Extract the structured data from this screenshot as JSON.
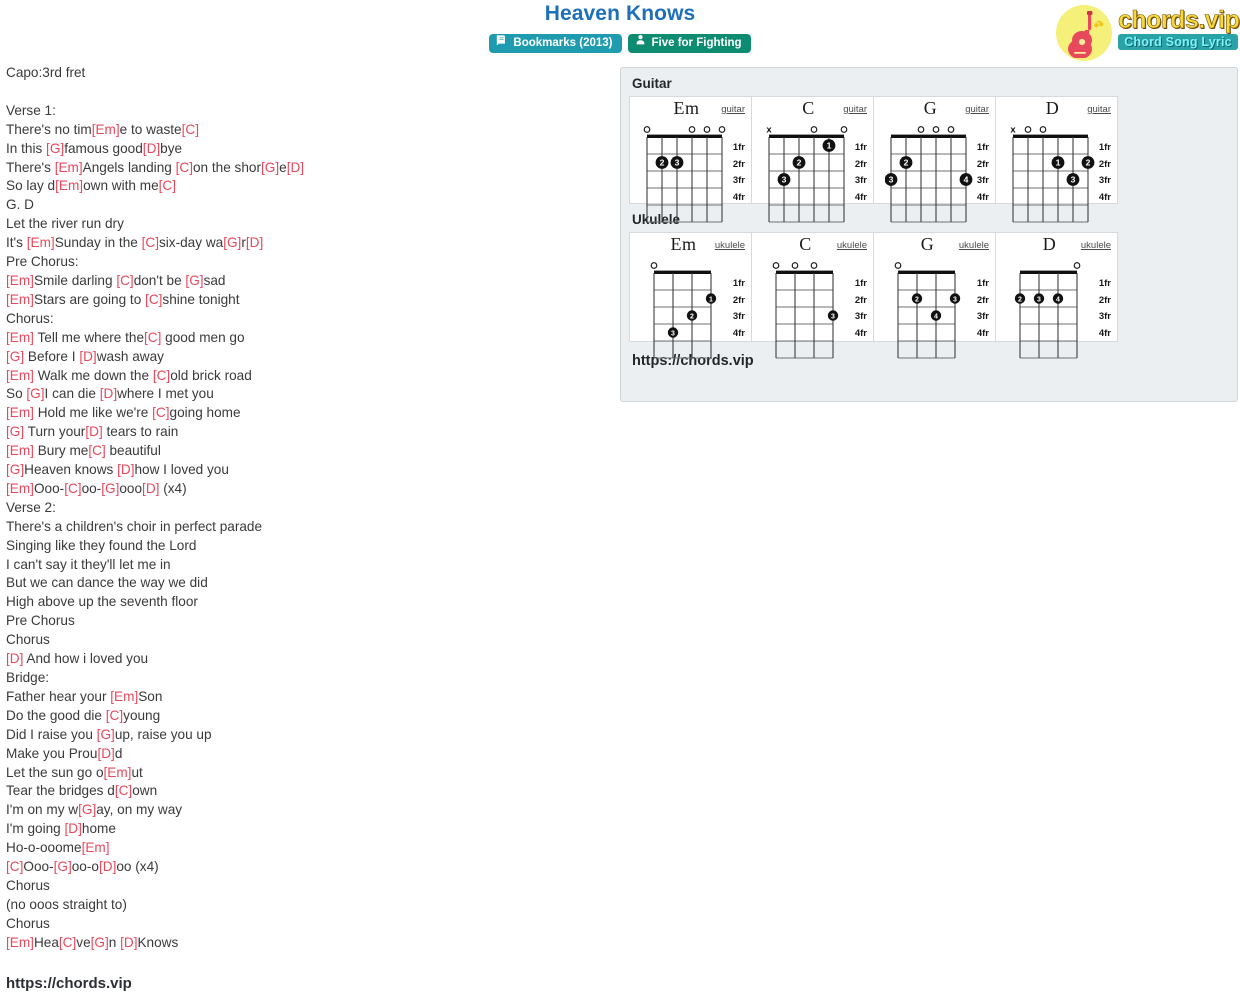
{
  "header": {
    "title": "Heaven Knows",
    "badges": [
      {
        "icon": "book-icon",
        "label": "Bookmarks (2013)",
        "color": "#1f9bb0"
      },
      {
        "icon": "user-icon",
        "label": "Five for Fighting",
        "color": "#0e8c72"
      }
    ]
  },
  "logo": {
    "main_text": "chords.vip",
    "sub_text": "Chord Song Lyric",
    "icon": "guitar-icon",
    "circle_color": "#f5f07a",
    "main_color": "#f8d93c",
    "sub_bg": "#2aa3a8",
    "sub_color": "#7af4f8"
  },
  "lyrics": {
    "chord_color": "#e8485c",
    "lines": [
      [
        {
          "t": "Capo:3rd fret"
        }
      ],
      [
        {
          "t": ""
        }
      ],
      [
        {
          "t": "Verse 1:"
        }
      ],
      [
        {
          "t": "There's no tim"
        },
        {
          "t": "[Em]",
          "c": true
        },
        {
          "t": "e to waste"
        },
        {
          "t": "[C]",
          "c": true
        }
      ],
      [
        {
          "t": "In this "
        },
        {
          "t": "[G]",
          "c": true
        },
        {
          "t": "famous good"
        },
        {
          "t": "[D]",
          "c": true
        },
        {
          "t": "bye"
        }
      ],
      [
        {
          "t": "There's "
        },
        {
          "t": "[Em]",
          "c": true
        },
        {
          "t": "Angels landing "
        },
        {
          "t": "[C]",
          "c": true
        },
        {
          "t": "on the shor"
        },
        {
          "t": "[G]",
          "c": true
        },
        {
          "t": "e"
        },
        {
          "t": "[D]",
          "c": true
        }
      ],
      [
        {
          "t": "So lay d"
        },
        {
          "t": "[Em]",
          "c": true
        },
        {
          "t": "own with me"
        },
        {
          "t": "[C]",
          "c": true
        }
      ],
      [
        {
          "t": "G. D"
        }
      ],
      [
        {
          "t": "Let the river run dry"
        }
      ],
      [
        {
          "t": "It's "
        },
        {
          "t": "[Em]",
          "c": true
        },
        {
          "t": "Sunday in the "
        },
        {
          "t": "[C]",
          "c": true
        },
        {
          "t": "six-day wa"
        },
        {
          "t": "[G]",
          "c": true
        },
        {
          "t": "r"
        },
        {
          "t": "[D]",
          "c": true
        }
      ],
      [
        {
          "t": "Pre Chorus:"
        }
      ],
      [
        {
          "t": "[Em]",
          "c": true
        },
        {
          "t": "Smile darling "
        },
        {
          "t": "[C]",
          "c": true
        },
        {
          "t": "don't be "
        },
        {
          "t": "[G]",
          "c": true
        },
        {
          "t": "sad"
        }
      ],
      [
        {
          "t": "[Em]",
          "c": true
        },
        {
          "t": "Stars are going to "
        },
        {
          "t": "[C]",
          "c": true
        },
        {
          "t": "shine tonight"
        }
      ],
      [
        {
          "t": "Chorus:"
        }
      ],
      [
        {
          "t": "[Em]",
          "c": true
        },
        {
          "t": " Tell me where the"
        },
        {
          "t": "[C]",
          "c": true
        },
        {
          "t": " good men go"
        }
      ],
      [
        {
          "t": "[G]",
          "c": true
        },
        {
          "t": " Before I "
        },
        {
          "t": "[D]",
          "c": true
        },
        {
          "t": "wash away"
        }
      ],
      [
        {
          "t": "[Em]",
          "c": true
        },
        {
          "t": " Walk me down the "
        },
        {
          "t": "[C]",
          "c": true
        },
        {
          "t": "old brick road"
        }
      ],
      [
        {
          "t": "So "
        },
        {
          "t": "[G]",
          "c": true
        },
        {
          "t": "I can die "
        },
        {
          "t": "[D]",
          "c": true
        },
        {
          "t": "where I met you"
        }
      ],
      [
        {
          "t": "[Em]",
          "c": true
        },
        {
          "t": " Hold me like we're "
        },
        {
          "t": "[C]",
          "c": true
        },
        {
          "t": "going home"
        }
      ],
      [
        {
          "t": "[G]",
          "c": true
        },
        {
          "t": " Turn your"
        },
        {
          "t": "[D]",
          "c": true
        },
        {
          "t": " tears to rain"
        }
      ],
      [
        {
          "t": "[Em]",
          "c": true
        },
        {
          "t": " Bury me"
        },
        {
          "t": "[C]",
          "c": true
        },
        {
          "t": " beautiful"
        }
      ],
      [
        {
          "t": "[G]",
          "c": true
        },
        {
          "t": "Heaven knows "
        },
        {
          "t": "[D]",
          "c": true
        },
        {
          "t": "how I loved you"
        }
      ],
      [
        {
          "t": "[Em]",
          "c": true
        },
        {
          "t": "Ooo-"
        },
        {
          "t": "[C]",
          "c": true
        },
        {
          "t": "oo-"
        },
        {
          "t": "[G]",
          "c": true
        },
        {
          "t": "ooo"
        },
        {
          "t": "[D]",
          "c": true
        },
        {
          "t": " (x4)"
        }
      ],
      [
        {
          "t": "Verse 2:"
        }
      ],
      [
        {
          "t": "There's a children's choir in perfect parade"
        }
      ],
      [
        {
          "t": "Singing like they found the Lord"
        }
      ],
      [
        {
          "t": "I can't say it they'll let me in"
        }
      ],
      [
        {
          "t": "But we can dance the way we did"
        }
      ],
      [
        {
          "t": "High above up the seventh floor"
        }
      ],
      [
        {
          "t": "Pre Chorus"
        }
      ],
      [
        {
          "t": "Chorus"
        }
      ],
      [
        {
          "t": "[D]",
          "c": true
        },
        {
          "t": " And how i loved you"
        }
      ],
      [
        {
          "t": "Bridge:"
        }
      ],
      [
        {
          "t": "Father hear your "
        },
        {
          "t": "[Em]",
          "c": true
        },
        {
          "t": "Son"
        }
      ],
      [
        {
          "t": "Do the good die "
        },
        {
          "t": "[C]",
          "c": true
        },
        {
          "t": "young"
        }
      ],
      [
        {
          "t": "Did I raise you "
        },
        {
          "t": "[G]",
          "c": true
        },
        {
          "t": "up, raise you up"
        }
      ],
      [
        {
          "t": "Make you Prou"
        },
        {
          "t": "[D]",
          "c": true
        },
        {
          "t": "d"
        }
      ],
      [
        {
          "t": "Let the sun go o"
        },
        {
          "t": "[Em]",
          "c": true
        },
        {
          "t": "ut"
        }
      ],
      [
        {
          "t": "Tear the bridges d"
        },
        {
          "t": "[C]",
          "c": true
        },
        {
          "t": "own"
        }
      ],
      [
        {
          "t": "I'm on my w"
        },
        {
          "t": "[G]",
          "c": true
        },
        {
          "t": "ay, on my way"
        }
      ],
      [
        {
          "t": "I'm going "
        },
        {
          "t": "[D]",
          "c": true
        },
        {
          "t": "home"
        }
      ],
      [
        {
          "t": "Ho-o-ooome"
        },
        {
          "t": "[Em]",
          "c": true
        }
      ],
      [
        {
          "t": "[C]",
          "c": true
        },
        {
          "t": "Ooo-"
        },
        {
          "t": "[G]",
          "c": true
        },
        {
          "t": "oo-o"
        },
        {
          "t": "[D]",
          "c": true
        },
        {
          "t": "oo (x4)"
        }
      ],
      [
        {
          "t": "Chorus"
        }
      ],
      [
        {
          "t": "(no ooos straight to)"
        }
      ],
      [
        {
          "t": "Chorus"
        }
      ],
      [
        {
          "t": "[Em]",
          "c": true
        },
        {
          "t": "Hea"
        },
        {
          "t": "[C]",
          "c": true
        },
        {
          "t": "ve"
        },
        {
          "t": "[G]",
          "c": true
        },
        {
          "t": "n "
        },
        {
          "t": "[D]",
          "c": true
        },
        {
          "t": "Knows"
        }
      ]
    ]
  },
  "footer": {
    "url": "https://chords.vip"
  },
  "panel": {
    "url": "https://chords.vip",
    "fret_labels": [
      "1fr",
      "2fr",
      "3fr",
      "4fr"
    ],
    "sections": [
      {
        "heading": "Guitar",
        "instrument_label": "guitar",
        "strings": 6,
        "chords": [
          {
            "name": "Em",
            "top": [
              "o",
              "",
              "",
              "o",
              "o",
              "o"
            ],
            "dots": [
              {
                "string": 5,
                "fret": 2,
                "finger": "2"
              },
              {
                "string": 4,
                "fret": 2,
                "finger": "3"
              }
            ]
          },
          {
            "name": "C",
            "top": [
              "x",
              "",
              "",
              "o",
              "",
              "o"
            ],
            "dots": [
              {
                "string": 2,
                "fret": 1,
                "finger": "1"
              },
              {
                "string": 4,
                "fret": 2,
                "finger": "2"
              },
              {
                "string": 5,
                "fret": 3,
                "finger": "3"
              }
            ]
          },
          {
            "name": "G",
            "top": [
              "",
              "",
              "o",
              "o",
              "o",
              ""
            ],
            "dots": [
              {
                "string": 5,
                "fret": 2,
                "finger": "2"
              },
              {
                "string": 6,
                "fret": 3,
                "finger": "3"
              },
              {
                "string": 1,
                "fret": 3,
                "finger": "4"
              }
            ]
          },
          {
            "name": "D",
            "top": [
              "x",
              "o",
              "o",
              "",
              "",
              ""
            ],
            "dots": [
              {
                "string": 3,
                "fret": 2,
                "finger": "1"
              },
              {
                "string": 1,
                "fret": 2,
                "finger": "2"
              },
              {
                "string": 2,
                "fret": 3,
                "finger": "3"
              }
            ]
          }
        ]
      },
      {
        "heading": "Ukulele",
        "instrument_label": "ukulele",
        "strings": 4,
        "chords": [
          {
            "name": "Em",
            "top": [
              "o",
              "",
              "",
              ""
            ],
            "dots": [
              {
                "string": 1,
                "fret": 2,
                "finger": "1"
              },
              {
                "string": 2,
                "fret": 3,
                "finger": "2"
              },
              {
                "string": 3,
                "fret": 4,
                "finger": "3"
              }
            ]
          },
          {
            "name": "C",
            "top": [
              "o",
              "o",
              "o",
              ""
            ],
            "dots": [
              {
                "string": 1,
                "fret": 3,
                "finger": "3"
              }
            ]
          },
          {
            "name": "G",
            "top": [
              "o",
              "",
              "",
              ""
            ],
            "dots": [
              {
                "string": 3,
                "fret": 2,
                "finger": "2"
              },
              {
                "string": 1,
                "fret": 2,
                "finger": "3"
              },
              {
                "string": 2,
                "fret": 3,
                "finger": "4"
              }
            ]
          },
          {
            "name": "D",
            "top": [
              "",
              "",
              "",
              "o"
            ],
            "dots": [
              {
                "string": 4,
                "fret": 2,
                "finger": "2"
              },
              {
                "string": 3,
                "fret": 2,
                "finger": "3"
              },
              {
                "string": 2,
                "fret": 2,
                "finger": "4"
              }
            ]
          }
        ]
      }
    ]
  }
}
